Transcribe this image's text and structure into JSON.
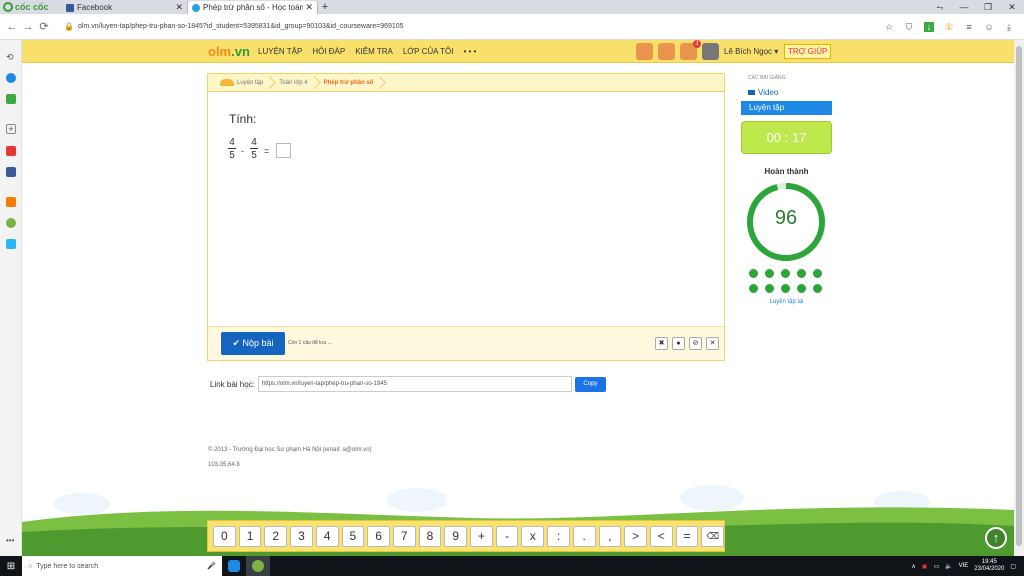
{
  "browser": {
    "brand": "cốc cốc",
    "tabs": [
      {
        "title": "Facebook"
      },
      {
        "title": "Phép trừ phân số - Học toán"
      }
    ],
    "new_tab": "+",
    "url": "olm.vn/luyen-tap/phep-tru-phan-so-1845?id_student=5395831&id_group=90103&id_courseware=969105"
  },
  "site": {
    "logo_main": "olm",
    "logo_suffix": ".vn",
    "nav": [
      "LUYỆN TẬP",
      "HỎI ĐÁP",
      "KIỂM TRA",
      "LỚP CỦA TÔI",
      "• • •"
    ],
    "notification_count": "1",
    "user_name": "Lê Bích Ngọc ▾",
    "help": "TRỢ GIÚP"
  },
  "breadcrumb": [
    "Luyện tập",
    "Toán lớp 4",
    "Phép trừ phân số"
  ],
  "exercise": {
    "prompt": "Tính:",
    "frac1": {
      "num": "4",
      "den": "5"
    },
    "minus": "-",
    "frac2": {
      "num": "4",
      "den": "5"
    },
    "equals": "=",
    "submit": "✔ Nộp bài",
    "remaining": "Còn 1 câu để lưu ...",
    "tools": [
      "✖",
      "●",
      "⊘",
      "✕"
    ]
  },
  "link": {
    "label": "Link bài học:",
    "value": "https://olm.vn/luyen-tap/phep-tru-phan-so-1845",
    "copy": "Copy"
  },
  "footer": {
    "copyright": "© 2013 - Trường Đại học Sư phạm Hà Nội (email: a@olm.vn)",
    "version": "103.35.64.8"
  },
  "side": {
    "section_title": "CÁC BÀI GIẢNG",
    "video": "Video",
    "practice": "Luyện tập",
    "timer": "00 : 17",
    "done_label": "Hoàn thành",
    "score": "96",
    "score_fraction": 0.96,
    "progress_dots": 10,
    "retry": "Luyện tập lại"
  },
  "keypad": [
    "0",
    "1",
    "2",
    "3",
    "4",
    "5",
    "6",
    "7",
    "8",
    "9",
    "+",
    "-",
    "x",
    ":",
    ".",
    ",",
    ">",
    "<",
    "="
  ],
  "taskbar": {
    "search_placeholder": "Type here to search",
    "lang": "VIE",
    "time": "19:45",
    "date": "23/04/2020"
  },
  "colors": {
    "header_yellow": "#f9e06a",
    "accent_blue": "#1565c0",
    "progress_green": "#2ca53a",
    "timer_green": "#bfe84c"
  }
}
